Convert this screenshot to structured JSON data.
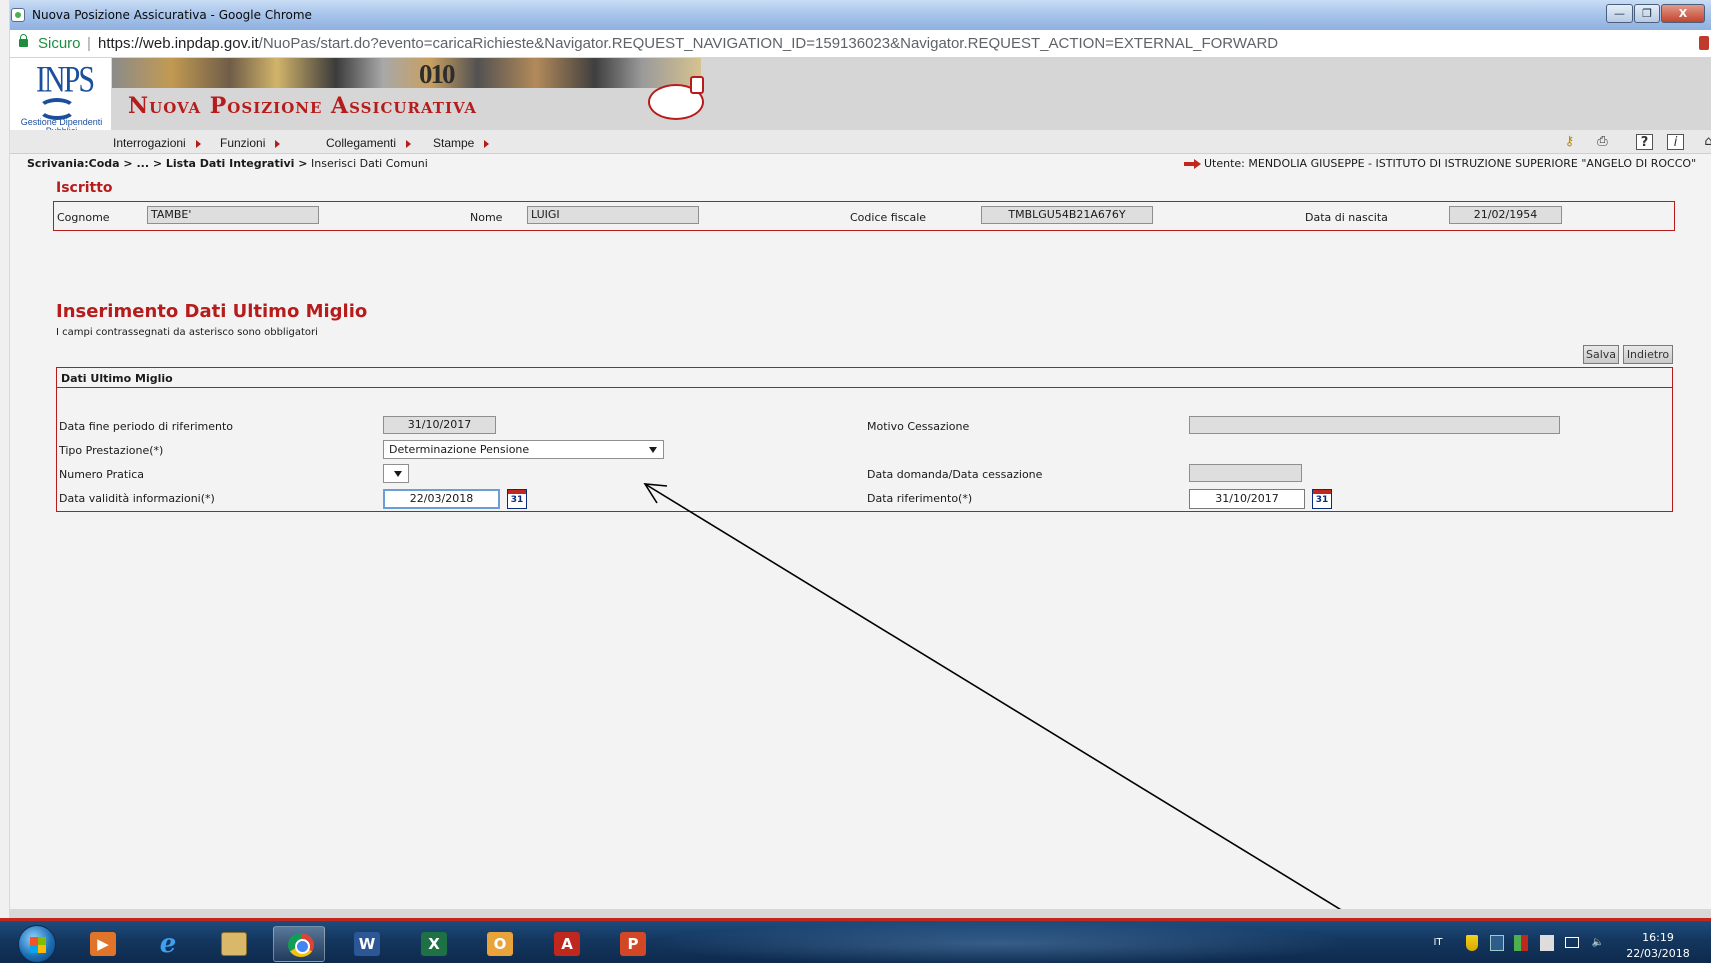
{
  "window": {
    "title": "Nuova Posizione Assicurativa - Google Chrome",
    "minimize_glyph": "—",
    "maximize_glyph": "❐",
    "close_glyph": "X"
  },
  "address_bar": {
    "security_label": "Sicuro",
    "separator": "|",
    "url_origin": "https://web.inpdap.gov.it",
    "url_path": "/NuoPas/start.do?evento=caricaRichieste&Navigator.REQUEST_NAVIGATION_ID=159136023&Navigator.REQUEST_ACTION=EXTERNAL_FORWARD"
  },
  "banner": {
    "logo_text": "INPS",
    "logo_caption": "Gestione Dipendenti Pubblici",
    "photo_strip_text": "010",
    "app_title": "Nuova Posizione Assicurativa",
    "brand_color": "#b71c1c"
  },
  "menu": {
    "items": [
      {
        "label": "Interrogazioni"
      },
      {
        "label": "Funzioni"
      },
      {
        "label": "Collegamenti"
      },
      {
        "label": "Stampe"
      }
    ],
    "tools": [
      {
        "icon": "key-icon",
        "glyph": "⚷"
      },
      {
        "icon": "printer-icon",
        "glyph": "⎙"
      },
      {
        "icon": "help-icon",
        "glyph": "?"
      },
      {
        "icon": "info-icon",
        "glyph": "i"
      },
      {
        "icon": "home-icon",
        "glyph": "⌂"
      }
    ]
  },
  "breadcrumb": {
    "part1": "Scrivania:Coda > ... > Lista Dati Integrativi >",
    "part2": " Inserisci Dati Comuni"
  },
  "user": {
    "text": "Utente: MENDOLIA GIUSEPPE - ISTITUTO DI ISTRUZIONE SUPERIORE \"ANGELO DI ROCCO\""
  },
  "iscritto": {
    "title": "Iscritto",
    "cognome_label": "Cognome",
    "cognome_value": "TAMBE'",
    "nome_label": "Nome",
    "nome_value": "LUIGI",
    "codice_fiscale_label": "Codice fiscale",
    "codice_fiscale_value": "TMBLGU54B21A676Y",
    "data_nascita_label": "Data di nascita",
    "data_nascita_value": "21/02/1954"
  },
  "section": {
    "title": "Inserimento Dati Ultimo Miglio",
    "subtitle": "I campi contrassegnati da asterisco sono obbligatori",
    "salva_label": "Salva",
    "indietro_label": "Indietro"
  },
  "dati": {
    "header": "Dati Ultimo Miglio",
    "data_fine_label": "Data fine periodo di riferimento",
    "data_fine_value": "31/10/2017",
    "motivo_cessazione_label": "Motivo Cessazione",
    "motivo_cessazione_value": "",
    "tipo_prestazione_label": "Tipo Prestazione(*)",
    "tipo_prestazione_value": "Determinazione Pensione",
    "numero_pratica_label": "Numero Pratica",
    "numero_pratica_value": "",
    "data_domanda_label": "Data domanda/Data cessazione",
    "data_domanda_value": "",
    "data_validita_label": "Data validità informazioni(*)",
    "data_validita_value": "22/03/2018",
    "data_riferimento_label": "Data riferimento(*)",
    "data_riferimento_value": "31/10/2017",
    "calendar_glyph": "31"
  },
  "taskbar": {
    "apps": [
      {
        "name": "Windows Media Player",
        "glyph": "▶"
      },
      {
        "name": "Internet Explorer",
        "glyph": "e"
      },
      {
        "name": "Esplora risorse",
        "glyph": ""
      },
      {
        "name": "Google Chrome",
        "glyph": ""
      },
      {
        "name": "Word",
        "glyph": "W"
      },
      {
        "name": "Excel",
        "glyph": "X"
      },
      {
        "name": "Outlook",
        "glyph": "O"
      },
      {
        "name": "Acrobat",
        "glyph": "A"
      },
      {
        "name": "PowerPoint",
        "glyph": "P"
      }
    ],
    "language": "IT",
    "volume_glyph": "🔈",
    "time": "16:19",
    "date": "22/03/2018"
  }
}
